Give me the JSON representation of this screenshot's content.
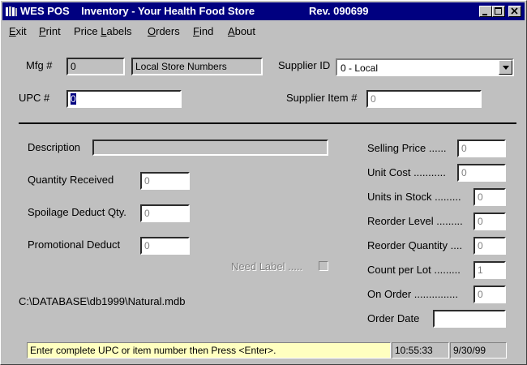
{
  "window": {
    "title": "WES POS    Inventory - Your Health Food Store",
    "revision": "Rev. 090699"
  },
  "menu": {
    "items": [
      {
        "id": "exit",
        "first": "E",
        "rest": "xit"
      },
      {
        "id": "print",
        "first": "P",
        "rest": "rint"
      },
      {
        "id": "price-labels",
        "first": "",
        "rest": "Price ",
        "ul": "L",
        "tail": "abels"
      },
      {
        "id": "orders",
        "first": "O",
        "rest": "rders"
      },
      {
        "id": "find",
        "first": "F",
        "rest": "ind"
      },
      {
        "id": "about",
        "first": "A",
        "rest": "bout"
      }
    ]
  },
  "form": {
    "mfg_label": "Mfg #",
    "mfg_value": "0",
    "mfg_name": "Local Store Numbers",
    "supplier_id_label": "Supplier ID",
    "supplier_id_value": "0 - Local",
    "upc_label": "UPC #",
    "upc_value": "0",
    "supplier_item_label": "Supplier Item #",
    "supplier_item_value": "0",
    "description_label": "Description",
    "description_value": "",
    "qty_received_label": "Quantity Received",
    "qty_received_value": "0",
    "spoilage_label": "Spoilage Deduct Qty.",
    "spoilage_value": "0",
    "promo_label": "Promotional Deduct",
    "promo_value": "0",
    "need_label": "Need Label .....",
    "db_path": "C:\\DATABASE\\db1999\\Natural.mdb",
    "selling_price_label": "Selling Price ......",
    "selling_price_value": "0",
    "unit_cost_label": "Unit Cost ...........",
    "unit_cost_value": "0",
    "units_in_stock_label": "Units in Stock .........",
    "units_in_stock_value": "0",
    "reorder_level_label": "Reorder Level .........",
    "reorder_level_value": "0",
    "reorder_qty_label": "Reorder Quantity ....",
    "reorder_qty_value": "0",
    "count_per_lot_label": "Count per Lot .........",
    "count_per_lot_value": "1",
    "on_order_label": "On Order ...............",
    "on_order_value": "0",
    "order_date_label": "Order Date",
    "order_date_value": ""
  },
  "status": {
    "message": "Enter complete UPC or item number then Press <Enter>.",
    "time": "10:55:33",
    "date": "9/30/99",
    "message_bg": "#ffffc0"
  }
}
